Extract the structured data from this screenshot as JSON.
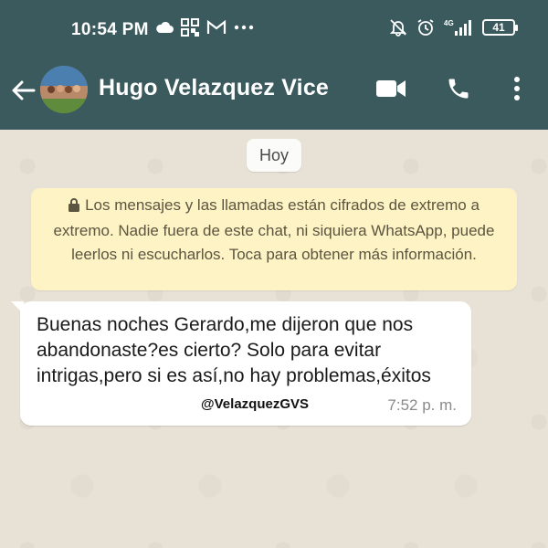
{
  "status_bar": {
    "time": "10:54 PM",
    "left_icons": [
      "cloud-icon",
      "qr-app-icon",
      "gmail-icon",
      "more-dots-icon"
    ],
    "right_icons": [
      "mute-icon",
      "alarm-icon",
      "signal-4g-icon"
    ],
    "network": "4G",
    "battery": "41"
  },
  "header": {
    "back_icon": "arrow-left-icon",
    "contact_name": "Hugo Velazquez Vice",
    "actions": [
      "video-call-icon",
      "phone-icon",
      "more-vert-icon"
    ]
  },
  "chat": {
    "date_label": "Hoy",
    "encryption_notice": "Los mensajes y las llamadas están cifrados de extremo a extremo. Nadie fuera de este chat, ni siquiera WhatsApp, puede leerlos ni escucharlos. Toca para obtener más información.",
    "messages": [
      {
        "direction": "incoming",
        "text": "Buenas noches Gerardo,me dijeron que nos abandonaste?es cierto? Solo para evitar intrigas,pero si es así,no hay problemas,éxitos",
        "time": "7:52 p. m."
      }
    ],
    "watermark": "@VelazquezGVS"
  },
  "colors": {
    "header_bg": "#3b5a5e",
    "chat_bg": "#e8e1d6",
    "notice_bg": "#fdf3c5",
    "bubble_bg": "#ffffff"
  }
}
